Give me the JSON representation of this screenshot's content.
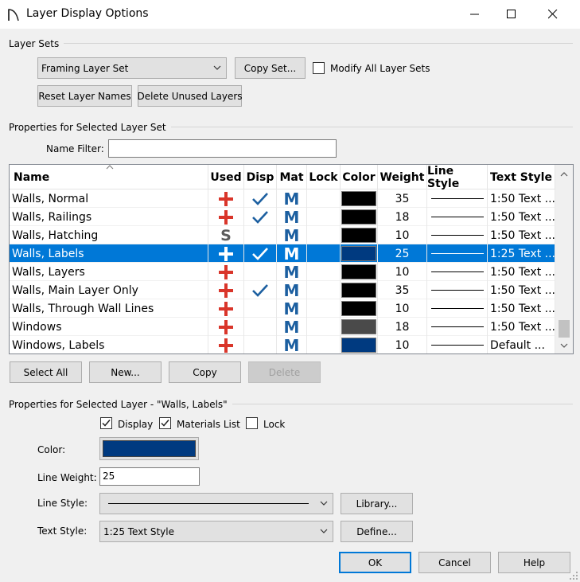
{
  "window": {
    "title": "Layer Display Options"
  },
  "layer_sets": {
    "group_label": "Layer Sets",
    "selected": "Framing Layer Set",
    "copy_label": "Copy Set...",
    "modify_all_label": "Modify All Layer Sets",
    "modify_all_checked": false,
    "reset_label": "Reset Layer Names",
    "delete_unused_label": "Delete Unused Layers"
  },
  "set_props": {
    "group_label": "Properties for Selected Layer Set",
    "filter_label": "Name Filter:",
    "filter_value": ""
  },
  "table": {
    "columns": [
      "Name",
      "Used",
      "Disp",
      "Mat",
      "Lock",
      "Color",
      "Weight",
      "Line Style",
      "Text Style"
    ],
    "rows": [
      {
        "name": "Walls,  Normal",
        "used": "plus",
        "disp": true,
        "mat": "M",
        "color": "#000000",
        "weight": "35",
        "text_style": "1:50 Text ...",
        "selected": false
      },
      {
        "name": "Walls,  Railings",
        "used": "plus",
        "disp": true,
        "mat": "M",
        "color": "#000000",
        "weight": "18",
        "text_style": "1:50 Text ...",
        "selected": false
      },
      {
        "name": "Walls, Hatching",
        "used": "S",
        "disp": false,
        "mat": "M",
        "color": "#000000",
        "weight": "10",
        "text_style": "1:50 Text ...",
        "selected": false
      },
      {
        "name": "Walls, Labels",
        "used": "plus",
        "disp": true,
        "mat": "M",
        "color": "#003a80",
        "weight": "25",
        "text_style": "1:25 Text ...",
        "selected": true
      },
      {
        "name": "Walls, Layers",
        "used": "plus",
        "disp": false,
        "mat": "M",
        "color": "#000000",
        "weight": "10",
        "text_style": "1:50 Text ...",
        "selected": false
      },
      {
        "name": "Walls, Main Layer Only",
        "used": "plus",
        "disp": true,
        "mat": "M",
        "color": "#000000",
        "weight": "35",
        "text_style": "1:50 Text ...",
        "selected": false
      },
      {
        "name": "Walls, Through Wall Lines",
        "used": "plus",
        "disp": false,
        "mat": "M",
        "color": "#000000",
        "weight": "10",
        "text_style": "1:50 Text ...",
        "selected": false
      },
      {
        "name": "Windows",
        "used": "plus",
        "disp": false,
        "mat": "M",
        "color": "#4a4a4a",
        "weight": "18",
        "text_style": "1:50 Text ...",
        "selected": false
      },
      {
        "name": "Windows, Labels",
        "used": "plus",
        "disp": false,
        "mat": "M",
        "color": "#003a80",
        "weight": "10",
        "text_style": "Default ...",
        "selected": false
      }
    ]
  },
  "table_buttons": {
    "select_all": "Select All",
    "new": "New...",
    "copy": "Copy",
    "delete": "Delete"
  },
  "layer_props": {
    "group_label": "Properties for Selected Layer - \"Walls, Labels\"",
    "display_label": "Display",
    "display_checked": true,
    "materials_label": "Materials List",
    "materials_checked": true,
    "lock_label": "Lock",
    "lock_checked": false,
    "color_label": "Color:",
    "color_value": "#003a80",
    "weight_label": "Line Weight:",
    "weight_value": "25",
    "line_style_label": "Line Style:",
    "library_label": "Library...",
    "text_style_label": "Text Style:",
    "text_style_value": "1:25 Text Style",
    "define_label": "Define..."
  },
  "footer": {
    "ok": "OK",
    "cancel": "Cancel",
    "help": "Help"
  },
  "colors": {
    "accent": "#0078d7",
    "plus_red": "#d9352a",
    "mat_blue": "#1c5fa0",
    "check_blue": "#1c5fa0"
  }
}
